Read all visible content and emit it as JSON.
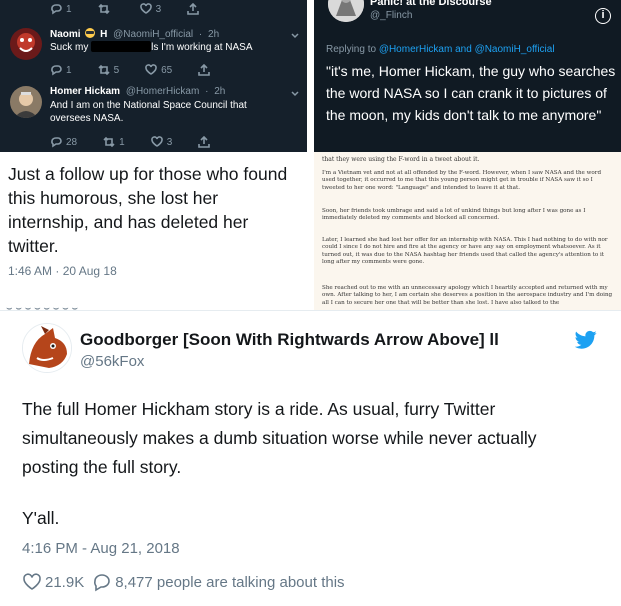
{
  "panel_a": {
    "top_row": {
      "reply_count": "1",
      "retweet_count": "",
      "like_count": "3"
    },
    "tweets": [
      {
        "name": "Naomi",
        "name_extra": "H",
        "handle": "@NaomiH_official",
        "time": "2h",
        "text_before": "Suck my",
        "text_after": "ls I'm working at NASA",
        "reply_count": "1",
        "retweet_count": "5",
        "like_count": "65"
      },
      {
        "name": "Homer Hickam",
        "handle": "@HomerHickam",
        "time": "2h",
        "text": "And I am on the National Space Council that oversees NASA.",
        "reply_count": "28",
        "retweet_count": "1",
        "like_count": "3"
      }
    ]
  },
  "panel_b": {
    "name": "Panic! at the Discourse",
    "handle": "@_Flinch",
    "replying_prefix": "Replying to",
    "replying_to_1": "@HomerHickam",
    "replying_and": "and",
    "replying_to_2": "@NaomiH_official",
    "text": "\"it's me, Homer Hickam, the guy who searches the word NASA so I can crank it to pictures of the moon, my kids don't talk to me anymore\""
  },
  "panel_c": {
    "text": "Just a follow up for those who found this humorous, she lost her internship, and has deleted her twitter.",
    "time": "1:46 AM · 20 Aug 18"
  },
  "panel_d": {
    "first_line": "that they were using the F-word in a tweet about it.",
    "paragraphs": [
      "I'm a Vietnam vet and not at all offended by the F-word. However, when I saw NASA and the word used together, it occurred to me that this young person might get in trouble if NASA saw it so I tweeted to her one word: \"Language\" and intended to leave it at that.",
      "Soon, her friends took umbrage and said a lot of unkind things but long after I was gone as I immediately deleted my comments and blocked all concerned.",
      "Later, I learned she had lost her offer for an internship with NASA. This I had nothing to do with nor could I since I do not hire and fire at the agency or have any say on employment whatsoever. As it turned out, it was due to the NASA hashtag her friends used that called the agency's attention to it long after my comments were gone.",
      "She reached out to me with an unnecessary apology which I heartily accepted and returned with my own. After talking to her, I am certain she deserves a position in the aerospace industry and I'm doing all I can to secure her one that will be better than she lost. I have also talked to the"
    ]
  },
  "panel_e": {
    "name": "Goodborger [Soon With Rightwards Arrow Above] ll",
    "handle": "@56kFox",
    "text": "The full Homer Hickham story is a ride. As usual, furry Twitter simultaneously makes a dumb situation worse while never actually posting the full story.",
    "text2": "Y'all.",
    "timestamp": "4:16 PM - Aug 21, 2018",
    "likes": "21.9K",
    "talking": "8,477 people are talking about this"
  },
  "colors": {
    "dark_bg": "#15202b",
    "twitter_blue": "#1da1f2",
    "muted": "#657786",
    "cream": "#fbf6ee"
  },
  "icons": [
    "reply-icon",
    "retweet-icon",
    "like-icon",
    "share-icon",
    "chevron-down-icon",
    "info-icon",
    "twitter-bird-icon",
    "heart-icon",
    "comment-icon"
  ]
}
